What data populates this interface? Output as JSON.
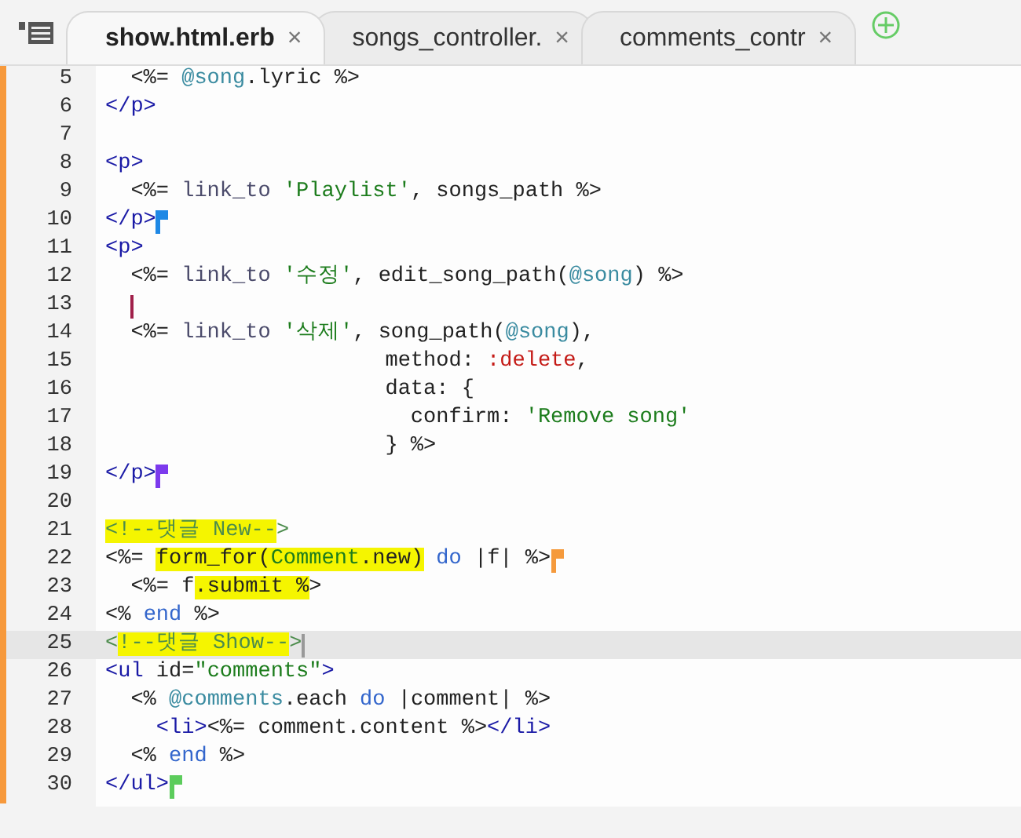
{
  "tabs": [
    {
      "label": "show.html.erb",
      "close": "×",
      "selected": true
    },
    {
      "label": "songs_controller.",
      "close": "×",
      "selected": false
    },
    {
      "label": "comments_contr",
      "close": "×",
      "selected": false
    }
  ],
  "lines": [
    {
      "number": "5",
      "selected": false,
      "caret": false,
      "tokens": [
        {
          "text": "  <%= ",
          "kind": "plain",
          "highlight": false
        },
        {
          "text": "@song",
          "kind": "ivar",
          "highlight": false
        },
        {
          "text": ".lyric %>",
          "kind": "plain",
          "highlight": false
        }
      ]
    },
    {
      "number": "6",
      "selected": false,
      "caret": false,
      "tokens": [
        {
          "text": "</p>",
          "kind": "tag",
          "highlight": false
        }
      ]
    },
    {
      "number": "7",
      "selected": false,
      "caret": false
    },
    {
      "number": "8",
      "selected": false,
      "caret": false,
      "tokens": [
        {
          "text": "<p>",
          "kind": "tag",
          "highlight": false
        }
      ]
    },
    {
      "number": "9",
      "selected": false,
      "caret": false,
      "tokens": [
        {
          "text": "  <%= ",
          "kind": "plain",
          "highlight": false
        },
        {
          "text": "link_to ",
          "kind": "method",
          "highlight": false
        },
        {
          "text": "'Playlist'",
          "kind": "string",
          "highlight": false
        },
        {
          "text": ", songs_path %>",
          "kind": "plain",
          "highlight": false
        }
      ]
    },
    {
      "number": "10",
      "selected": false,
      "caret": false,
      "color": "#1e88e5",
      "tokens": [
        {
          "text": "</p>",
          "kind": "tag",
          "highlight": false
        }
      ]
    },
    {
      "number": "11",
      "selected": false,
      "caret": false,
      "tokens": [
        {
          "text": "<p>",
          "kind": "tag",
          "highlight": false
        }
      ]
    },
    {
      "number": "12",
      "selected": false,
      "caret": false,
      "tokens": [
        {
          "text": "  <%= ",
          "kind": "plain",
          "highlight": false
        },
        {
          "text": "link_to ",
          "kind": "method",
          "highlight": false
        },
        {
          "text": "'수정'",
          "kind": "string",
          "highlight": false
        },
        {
          "text": ", edit_song_path(",
          "kind": "plain",
          "highlight": false
        },
        {
          "text": "@song",
          "kind": "ivar",
          "highlight": false
        },
        {
          "text": ") %>",
          "kind": "plain",
          "highlight": false
        }
      ]
    },
    {
      "number": "13",
      "selected": false,
      "caret": true
    },
    {
      "number": "14",
      "selected": false,
      "caret": false,
      "tokens": [
        {
          "text": "  <%= ",
          "kind": "plain",
          "highlight": false
        },
        {
          "text": "link_to ",
          "kind": "method",
          "highlight": false
        },
        {
          "text": "'삭제'",
          "kind": "string",
          "highlight": false
        },
        {
          "text": ", song_path(",
          "kind": "plain",
          "highlight": false
        },
        {
          "text": "@song",
          "kind": "ivar",
          "highlight": false
        },
        {
          "text": "),",
          "kind": "plain",
          "highlight": false
        }
      ]
    },
    {
      "number": "15",
      "selected": false,
      "caret": false,
      "tokens": [
        {
          "text": "                      method: ",
          "kind": "plain",
          "highlight": false
        },
        {
          "text": ":delete",
          "kind": "symbol",
          "highlight": false
        },
        {
          "text": ",",
          "kind": "plain",
          "highlight": false
        }
      ]
    },
    {
      "number": "16",
      "selected": false,
      "caret": false,
      "tokens": [
        {
          "text": "                      data: {",
          "kind": "plain",
          "highlight": false
        }
      ]
    },
    {
      "number": "17",
      "selected": false,
      "caret": false,
      "tokens": [
        {
          "text": "                        confirm: ",
          "kind": "plain",
          "highlight": false
        },
        {
          "text": "'Remove song'",
          "kind": "string",
          "highlight": false
        }
      ]
    },
    {
      "number": "18",
      "selected": false,
      "caret": false,
      "tokens": [
        {
          "text": "                      } %>",
          "kind": "plain",
          "highlight": false
        }
      ]
    },
    {
      "number": "19",
      "selected": false,
      "caret": false,
      "color": "#7c3aed",
      "tokens": [
        {
          "text": "</p>",
          "kind": "tag",
          "highlight": false
        }
      ]
    },
    {
      "number": "20",
      "selected": false,
      "caret": false
    },
    {
      "number": "21",
      "selected": false,
      "caret": false,
      "tokens": [
        {
          "text": "<!--댓글 New--",
          "kind": "comment",
          "highlight": true
        },
        {
          "text": ">",
          "kind": "comment",
          "highlight": false
        }
      ]
    },
    {
      "number": "22",
      "selected": false,
      "caret": false,
      "color": "#f59a3c",
      "tokens": [
        {
          "text": "<%= ",
          "kind": "plain",
          "highlight": false
        },
        {
          "text": "form_for(",
          "kind": "plain",
          "highlight": true
        },
        {
          "text": "Comment",
          "kind": "const",
          "highlight": true
        },
        {
          "text": ".new)",
          "kind": "plain",
          "highlight": true
        },
        {
          "text": " do",
          "kind": "keyword",
          "highlight": false
        },
        {
          "text": " |f| %>",
          "kind": "plain",
          "highlight": false
        }
      ]
    },
    {
      "number": "23",
      "selected": false,
      "caret": false,
      "tokens": [
        {
          "text": "  <%= f",
          "kind": "plain",
          "highlight": false
        },
        {
          "text": ".submit %",
          "kind": "plain",
          "highlight": true
        },
        {
          "text": ">",
          "kind": "plain",
          "highlight": false
        }
      ]
    },
    {
      "number": "24",
      "selected": false,
      "caret": false,
      "tokens": [
        {
          "text": "<% ",
          "kind": "plain",
          "highlight": false
        },
        {
          "text": "end",
          "kind": "keyword",
          "highlight": false
        },
        {
          "text": " %>",
          "kind": "plain",
          "highlight": false
        }
      ]
    },
    {
      "number": "25",
      "selected": true,
      "caret": true,
      "tokens": [
        {
          "text": "<",
          "kind": "comment",
          "highlight": false
        },
        {
          "text": "!--댓글 Show--",
          "kind": "comment",
          "highlight": true
        },
        {
          "text": ">",
          "kind": "comment",
          "highlight": false
        }
      ]
    },
    {
      "number": "26",
      "selected": false,
      "caret": false,
      "tokens": [
        {
          "text": "<ul",
          "kind": "tag",
          "highlight": false
        },
        {
          "text": " id=",
          "kind": "plain",
          "highlight": false
        },
        {
          "text": "\"comments\"",
          "kind": "string",
          "highlight": false
        },
        {
          "text": ">",
          "kind": "tag",
          "highlight": false
        }
      ]
    },
    {
      "number": "27",
      "selected": false,
      "caret": false,
      "tokens": [
        {
          "text": "  <% ",
          "kind": "plain",
          "highlight": false
        },
        {
          "text": "@comments",
          "kind": "ivar",
          "highlight": false
        },
        {
          "text": ".each ",
          "kind": "plain",
          "highlight": false
        },
        {
          "text": "do",
          "kind": "keyword",
          "highlight": false
        },
        {
          "text": " |comment| %>",
          "kind": "plain",
          "highlight": false
        }
      ]
    },
    {
      "number": "28",
      "selected": false,
      "caret": false,
      "tokens": [
        {
          "text": "    <li>",
          "kind": "tag",
          "highlight": false
        },
        {
          "text": "<%= comment.content %>",
          "kind": "plain",
          "highlight": false
        },
        {
          "text": "</li>",
          "kind": "tag",
          "highlight": false
        }
      ]
    },
    {
      "number": "29",
      "selected": false,
      "caret": false,
      "tokens": [
        {
          "text": "  <% ",
          "kind": "plain",
          "highlight": false
        },
        {
          "text": "end",
          "kind": "keyword",
          "highlight": false
        },
        {
          "text": " %>",
          "kind": "plain",
          "highlight": false
        }
      ]
    },
    {
      "number": "30",
      "selected": false,
      "caret": false,
      "color": "#5ccc5c",
      "tokens": [
        {
          "text": "</ul>",
          "kind": "tag",
          "highlight": false
        }
      ]
    }
  ]
}
